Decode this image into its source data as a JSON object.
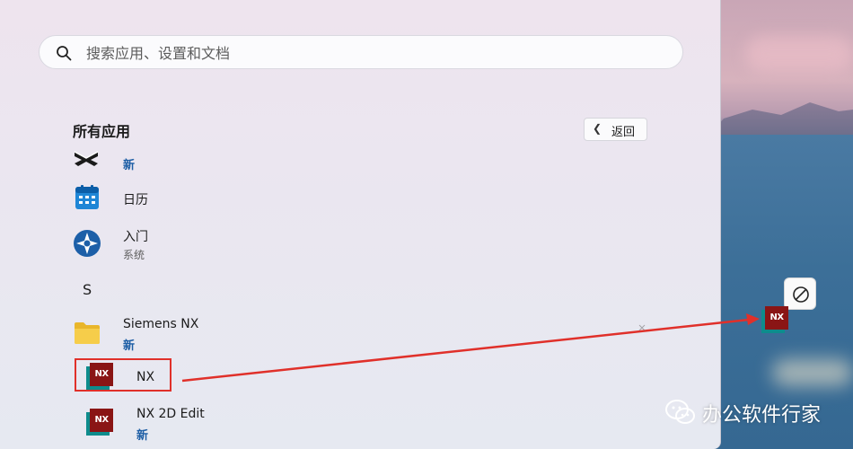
{
  "search": {
    "placeholder": "搜索应用、设置和文档"
  },
  "section": {
    "title": "所有应用",
    "back_label": "返回"
  },
  "apps": [
    {
      "name": "",
      "subtitle": "新",
      "icon": "capcut-logo-icon"
    },
    {
      "name": "日历",
      "subtitle": "",
      "icon": "calendar-icon"
    },
    {
      "name": "入门",
      "subtitle": "系统",
      "icon": "get-started-icon"
    },
    {
      "letter": "S"
    },
    {
      "name": "Siemens NX",
      "subtitle": "新",
      "icon": "folder-icon"
    },
    {
      "name": "NX",
      "subtitle": "",
      "icon": "nx-icon"
    },
    {
      "name": "NX 2D Edit",
      "subtitle": "新",
      "icon": "nx-icon"
    }
  ],
  "nx_icon_text": "NX",
  "drag_ghost": {
    "icon": "nx-icon",
    "badge": "no-entry-icon"
  },
  "watermark": {
    "text": "办公软件行家",
    "icon": "wechat-icon"
  },
  "colors": {
    "accent_new": "#1d5ea5",
    "annotation": "#e0302a",
    "nx_red": "#8a1515",
    "nx_teal": "#0e8c8c"
  }
}
